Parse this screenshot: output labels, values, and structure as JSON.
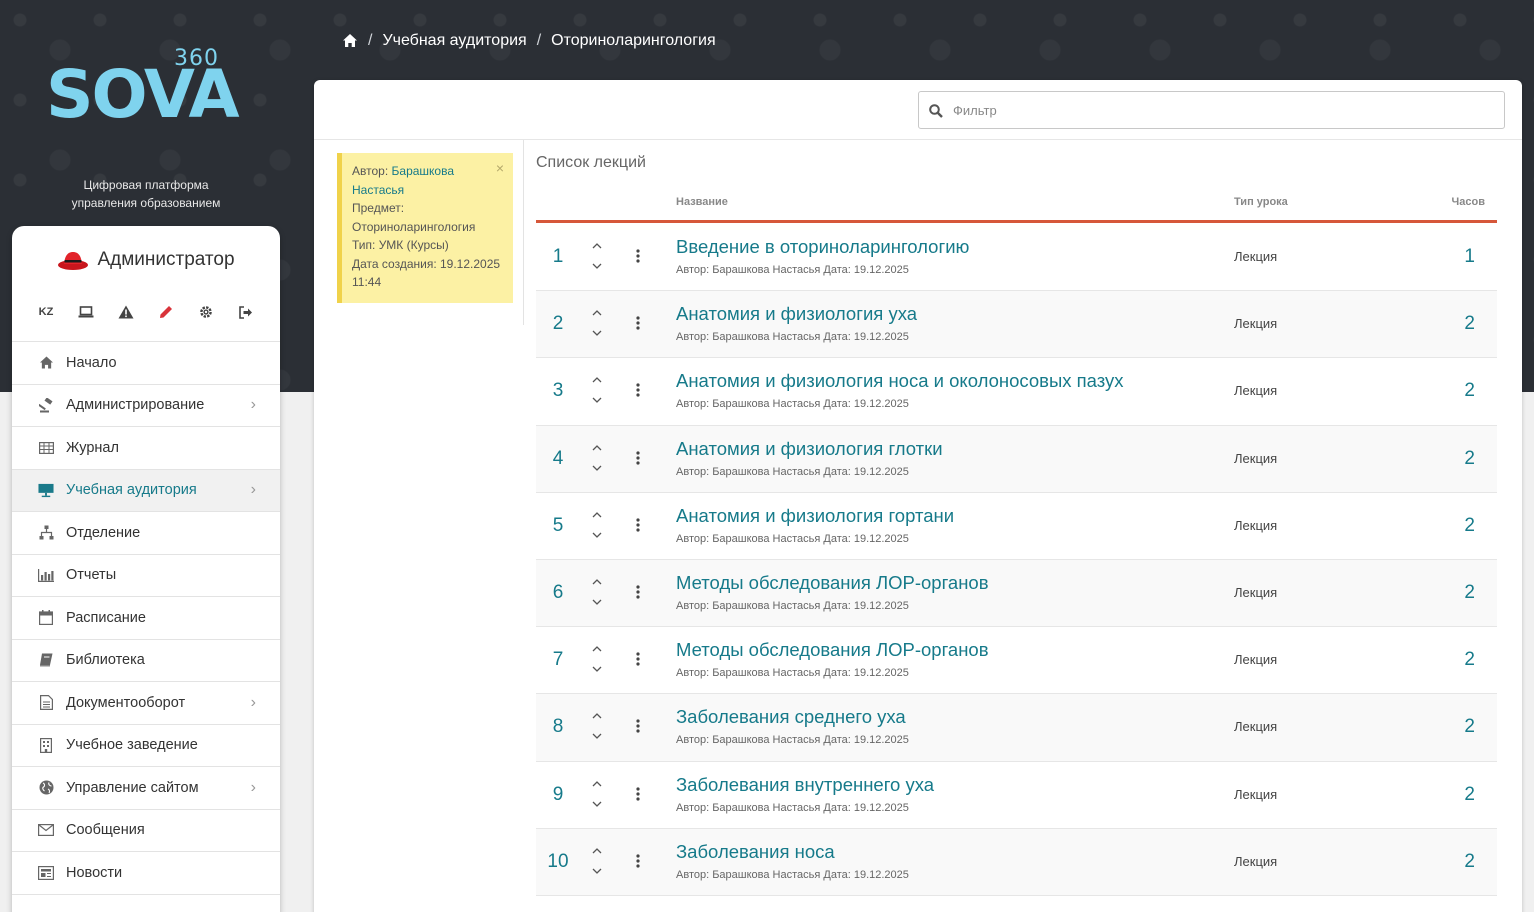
{
  "brand": {
    "logo_text": "SOVA",
    "logo_number": "360",
    "tagline_line1": "Цифровая платформа",
    "tagline_line2": "управления образованием"
  },
  "breadcrumb": {
    "items": [
      "Учебная аудитория",
      "Оториноларингология"
    ],
    "separator": "/"
  },
  "user": {
    "name": "Администратор"
  },
  "quick_actions": [
    {
      "label": "KZ",
      "icon": "language-kz"
    },
    {
      "label": "",
      "icon": "laptop-icon"
    },
    {
      "label": "",
      "icon": "warning-icon"
    },
    {
      "label": "",
      "icon": "pencil-icon"
    },
    {
      "label": "",
      "icon": "gear-icon"
    },
    {
      "label": "",
      "icon": "logout-icon"
    }
  ],
  "nav": [
    {
      "label": "Начало",
      "icon": "home-icon",
      "chevron": false
    },
    {
      "label": "Администрирование",
      "icon": "gavel-icon",
      "chevron": true
    },
    {
      "label": "Журнал",
      "icon": "table-icon",
      "chevron": false
    },
    {
      "label": "Учебная аудитория",
      "icon": "classroom-icon",
      "chevron": true,
      "active": true
    },
    {
      "label": "Отделение",
      "icon": "sitemap-icon",
      "chevron": false
    },
    {
      "label": "Отчеты",
      "icon": "bar-chart-icon",
      "chevron": false
    },
    {
      "label": "Расписание",
      "icon": "calendar-icon",
      "chevron": false
    },
    {
      "label": "Библиотека",
      "icon": "book-icon",
      "chevron": false
    },
    {
      "label": "Документооборот",
      "icon": "document-icon",
      "chevron": true
    },
    {
      "label": "Учебное заведение",
      "icon": "building-icon",
      "chevron": false
    },
    {
      "label": "Управление сайтом",
      "icon": "globe-icon",
      "chevron": true
    },
    {
      "label": "Сообщения",
      "icon": "envelope-icon",
      "chevron": false
    },
    {
      "label": "Новости",
      "icon": "newspaper-icon",
      "chevron": false
    }
  ],
  "filter": {
    "placeholder": "Фильтр",
    "value": ""
  },
  "note": {
    "author_label": "Автор:",
    "author": "Барашкова Настасья",
    "subject_label": "Предмет:",
    "subject": "Оториноларингология",
    "type_label": "Тип:",
    "type": "УМК (Курсы)",
    "created_label": "Дата создания:",
    "created": "19.12.2025 11:44",
    "close": "×"
  },
  "lectures": {
    "title": "Список лекций",
    "columns": {
      "name": "Название",
      "type": "Тип урока",
      "hours": "Часов"
    },
    "rows": [
      {
        "num": "1",
        "title": "Введение в оториноларингологию",
        "meta": "Автор: Барашкова Настасья Дата: 19.12.2025",
        "type": "Лекция",
        "hours": "1"
      },
      {
        "num": "2",
        "title": "Анатомия и физиология уха",
        "meta": "Автор: Барашкова Настасья Дата: 19.12.2025",
        "type": "Лекция",
        "hours": "2"
      },
      {
        "num": "3",
        "title": "Анатомия и физиология носа и околоносовых пазух",
        "meta": "Автор: Барашкова Настасья Дата: 19.12.2025",
        "type": "Лекция",
        "hours": "2"
      },
      {
        "num": "4",
        "title": "Анатомия и физиология глотки",
        "meta": "Автор: Барашкова Настасья Дата: 19.12.2025",
        "type": "Лекция",
        "hours": "2"
      },
      {
        "num": "5",
        "title": "Анатомия и физиология гортани",
        "meta": "Автор: Барашкова Настасья Дата: 19.12.2025",
        "type": "Лекция",
        "hours": "2"
      },
      {
        "num": "6",
        "title": "Методы обследования ЛОР-органов",
        "meta": "Автор: Барашкова Настасья Дата: 19.12.2025",
        "type": "Лекция",
        "hours": "2"
      },
      {
        "num": "7",
        "title": "Методы обследования ЛОР-органов",
        "meta": "Автор: Барашкова Настасья Дата: 19.12.2025",
        "type": "Лекция",
        "hours": "2"
      },
      {
        "num": "8",
        "title": "Заболевания среднего уха",
        "meta": "Автор: Барашкова Настасья Дата: 19.12.2025",
        "type": "Лекция",
        "hours": "2"
      },
      {
        "num": "9",
        "title": "Заболевания внутреннего уха",
        "meta": "Автор: Барашкова Настасья Дата: 19.12.2025",
        "type": "Лекция",
        "hours": "2"
      },
      {
        "num": "10",
        "title": "Заболевания носа",
        "meta": "Автор: Барашкова Настасья Дата: 19.12.2025",
        "type": "Лекция",
        "hours": "2"
      }
    ]
  },
  "colors": {
    "accent": "#167a8a",
    "logo": "#7fd3ee",
    "header_bg": "#2b2f35",
    "table_rule": "#d6573a",
    "note_bg": "#fcf1a4"
  }
}
